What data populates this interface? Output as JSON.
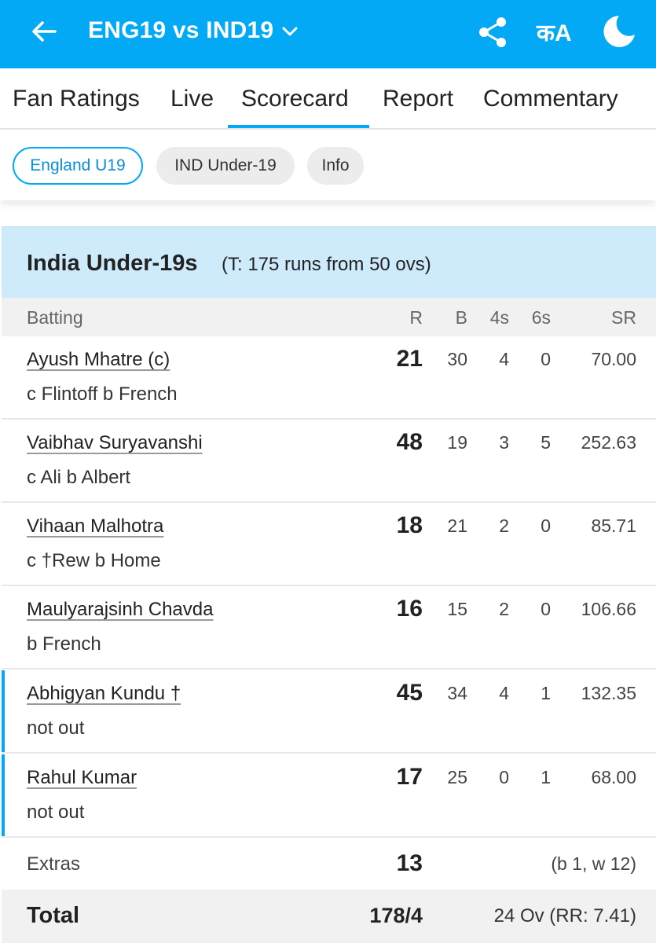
{
  "appbar": {
    "title": "ENG19 vs IND19",
    "lang_label": "कA",
    "icons": [
      "back-arrow-icon",
      "chevron-down-icon",
      "share-icon",
      "moon-icon"
    ],
    "bg_color": "#03a9f4"
  },
  "tabs": [
    {
      "label": "Fan Ratings"
    },
    {
      "label": "Live"
    },
    {
      "label": "Scorecard",
      "active": true
    },
    {
      "label": "Report"
    },
    {
      "label": "Commentary"
    }
  ],
  "team_chips": [
    {
      "label": "England U19",
      "selected": true
    },
    {
      "label": "IND Under-19",
      "selected": false
    },
    {
      "label": "Info",
      "selected": false
    }
  ],
  "innings": {
    "team": "India Under-19s",
    "target": "(T: 175 runs from 50 ovs)"
  },
  "batting_header": {
    "batting": "Batting",
    "r": "R",
    "b": "B",
    "fours": "4s",
    "sixes": "6s",
    "sr": "SR"
  },
  "batters": [
    {
      "name": "Ayush Mhatre (c)",
      "dismissal": "c Flintoff b French",
      "r": "21",
      "b": "30",
      "fours": "4",
      "sixes": "0",
      "sr": "70.00",
      "at_crease": false
    },
    {
      "name": "Vaibhav Suryavanshi",
      "dismissal": "c Ali b Albert",
      "r": "48",
      "b": "19",
      "fours": "3",
      "sixes": "5",
      "sr": "252.63",
      "at_crease": false
    },
    {
      "name": "Vihaan Malhotra",
      "dismissal": "c †Rew b Home",
      "r": "18",
      "b": "21",
      "fours": "2",
      "sixes": "0",
      "sr": "85.71",
      "at_crease": false
    },
    {
      "name": "Maulyarajsinh Chavda",
      "dismissal": "b French",
      "r": "16",
      "b": "15",
      "fours": "2",
      "sixes": "0",
      "sr": "106.66",
      "at_crease": false
    },
    {
      "name": "Abhigyan Kundu †",
      "dismissal": "not out",
      "r": "45",
      "b": "34",
      "fours": "4",
      "sixes": "1",
      "sr": "132.35",
      "at_crease": true
    },
    {
      "name": "Rahul Kumar",
      "dismissal": "not out",
      "r": "17",
      "b": "25",
      "fours": "0",
      "sixes": "1",
      "sr": "68.00",
      "at_crease": true
    }
  ],
  "extras": {
    "label": "Extras",
    "value": "13",
    "detail": "(b 1, w 12)"
  },
  "total": {
    "label": "Total",
    "score": "178/4",
    "overs": "24 Ov (RR: 7.41)"
  }
}
